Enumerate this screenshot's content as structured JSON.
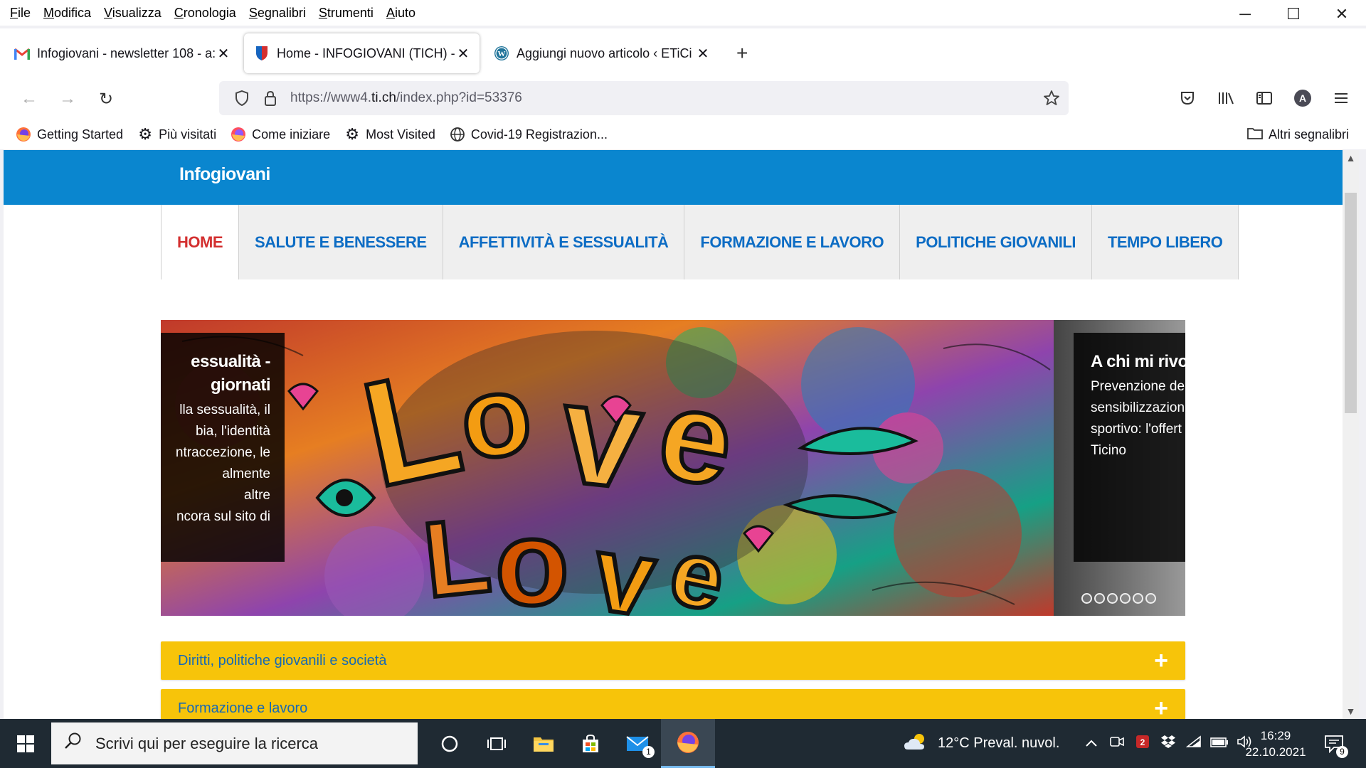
{
  "menubar": {
    "items": [
      "File",
      "Modifica",
      "Visualizza",
      "Cronologia",
      "Segnalibri",
      "Strumenti",
      "Aiuto"
    ]
  },
  "window_controls": {
    "minimize": "─",
    "maximize": "☐",
    "close": "✕"
  },
  "tabs": [
    {
      "title": "Infogiovani - newsletter 108 - a:",
      "icon": "gmail-icon",
      "active": false
    },
    {
      "title": "Home - INFOGIOVANI (TICH) - I",
      "icon": "ticino-shield-icon",
      "active": true
    },
    {
      "title": "Aggiungi nuovo articolo ‹ ETiCi",
      "icon": "wordpress-icon",
      "active": false
    }
  ],
  "new_tab_label": "+",
  "nav": {
    "back": "←",
    "forward": "→",
    "reload": "↻",
    "url_prefix": "https://www4.",
    "url_domain": "ti.ch",
    "url_suffix": "/index.php?id=53376"
  },
  "bookmarks": [
    {
      "label": "Getting Started",
      "icon": "firefox-icon"
    },
    {
      "label": "Più visitati",
      "icon": "gear-icon"
    },
    {
      "label": "Come iniziare",
      "icon": "firefox-icon"
    },
    {
      "label": "Most Visited",
      "icon": "gear-icon"
    },
    {
      "label": "Covid-19 Registrazion...",
      "icon": "globe-icon"
    }
  ],
  "other_bookmarks": "Altri segnalibri",
  "site": {
    "title": "Infogiovani",
    "nav": [
      "HOME",
      "SALUTE E BENESSERE",
      "AFFETTIVITÀ E SESSUALITÀ",
      "FORMAZIONE E LAVORO",
      "POLITICHE GIOVANILI",
      "TEMPO LIBERO"
    ],
    "slider": {
      "left_caption": {
        "title_lines": [
          "essualità -",
          "giornati"
        ],
        "text_lines": [
          "lla sessualità, il",
          "bia, l'identità",
          "ntraccezione, le",
          "almente",
          "altre",
          "ncora sul sito di"
        ]
      },
      "right_caption": {
        "title": "A chi mi rivolgo",
        "text_lines": [
          "Prevenzione de",
          "sensibilizzazion",
          "sportivo: l'offert",
          "Ticino"
        ]
      },
      "dot_count": 6
    },
    "accordion": [
      {
        "title": "Diritti, politiche giovanili e società",
        "toggle": "+"
      },
      {
        "title": "Formazione e lavoro",
        "toggle": "+"
      }
    ]
  },
  "taskbar": {
    "search_placeholder": "Scrivi qui per eseguire la ricerca",
    "weather": "12°C  Preval. nuvol.",
    "time": "16:29",
    "date": "22.10.2021",
    "mail_badge": "1",
    "notif_badge": "9"
  },
  "colors": {
    "site_header": "#0a86cf",
    "nav_text": "#0c6cc4",
    "nav_active": "#d32f2f",
    "accordion": "#f7c40a"
  }
}
